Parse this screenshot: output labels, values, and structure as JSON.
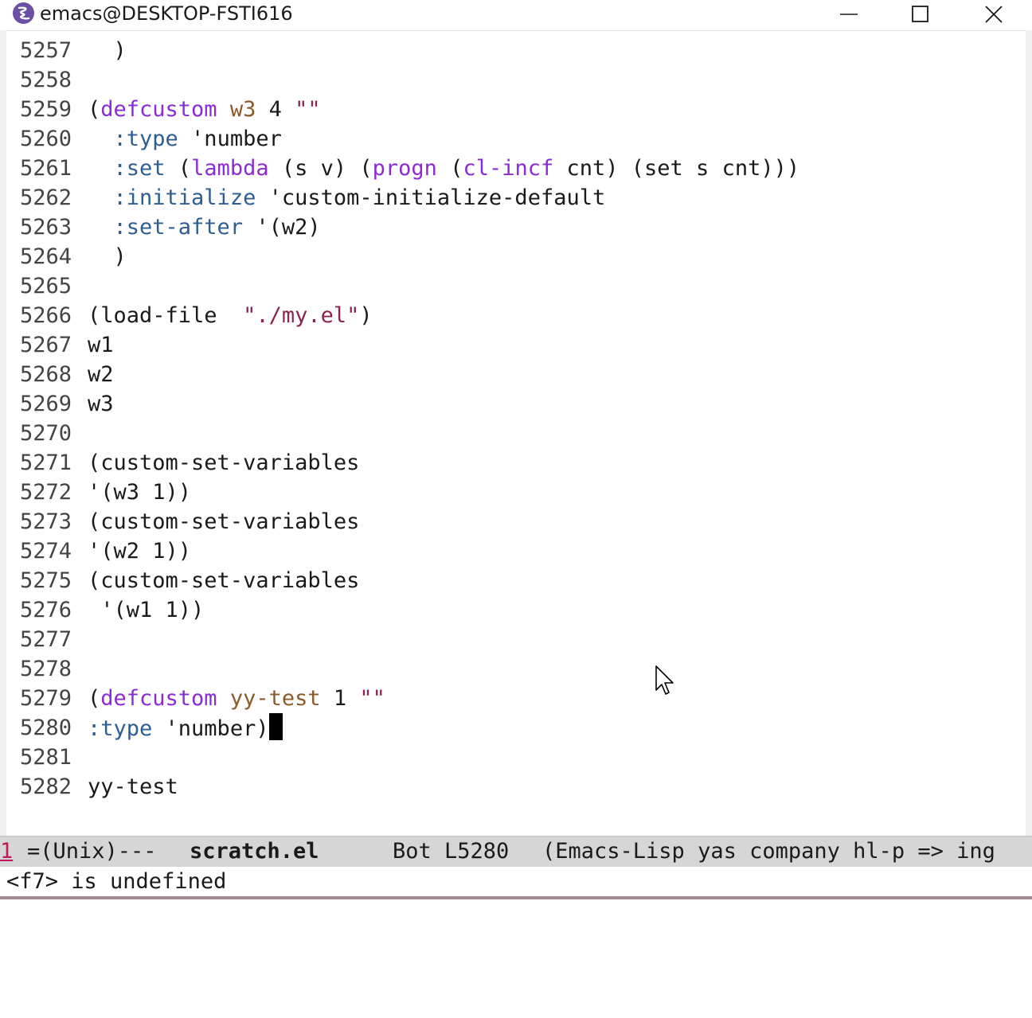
{
  "window": {
    "title": "emacs@DESKTOP-FSTI616"
  },
  "editor": {
    "lines": [
      {
        "num": "5257",
        "code": "  )"
      },
      {
        "num": "5258",
        "code": ""
      },
      {
        "num": "5259",
        "code": "(defcustom w3 4 \"\""
      },
      {
        "num": "5260",
        "code": "  :type 'number"
      },
      {
        "num": "5261",
        "code": "  :set (lambda (s v) (progn (cl-incf cnt) (set s cnt)))"
      },
      {
        "num": "5262",
        "code": "  :initialize 'custom-initialize-default"
      },
      {
        "num": "5263",
        "code": "  :set-after '(w2)"
      },
      {
        "num": "5264",
        "code": "  )"
      },
      {
        "num": "5265",
        "code": ""
      },
      {
        "num": "5266",
        "code": "(load-file  \"./my.el\")"
      },
      {
        "num": "5267",
        "code": "w1"
      },
      {
        "num": "5268",
        "code": "w2"
      },
      {
        "num": "5269",
        "code": "w3"
      },
      {
        "num": "5270",
        "code": ""
      },
      {
        "num": "5271",
        "code": "(custom-set-variables"
      },
      {
        "num": "5272",
        "code": "'(w3 1))"
      },
      {
        "num": "5273",
        "code": "(custom-set-variables"
      },
      {
        "num": "5274",
        "code": "'(w2 1))"
      },
      {
        "num": "5275",
        "code": "(custom-set-variables"
      },
      {
        "num": "5276",
        "code": " '(w1 1))"
      },
      {
        "num": "5277",
        "code": ""
      },
      {
        "num": "5278",
        "code": ""
      },
      {
        "num": "5279",
        "code": "(defcustom yy-test 1 \"\""
      },
      {
        "num": "5280",
        "code": ":type 'number)"
      },
      {
        "num": "5281",
        "code": ""
      },
      {
        "num": "5282",
        "code": "yy-test"
      }
    ]
  },
  "modeline": {
    "window_number": "1",
    "status": "=(Unix)---",
    "buffer_name": "scratch.el",
    "position": "Bot L5280",
    "modes": "(Emacs-Lisp yas company hl-p => ing"
  },
  "echo_area": {
    "message": "<f7> is undefined"
  },
  "colors": {
    "keyword": "#8b2bd4",
    "variable_name": "#8b5a2b",
    "string": "#8b2252",
    "constant": "#2d5d91",
    "modeline_bg": "#d6d6d6",
    "window_number": "#c2185b"
  },
  "icons": [
    "emacs-icon",
    "minimize-icon",
    "maximize-icon",
    "close-icon",
    "mouse-pointer-icon"
  ]
}
